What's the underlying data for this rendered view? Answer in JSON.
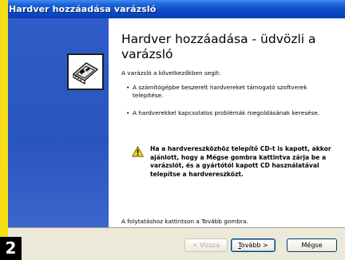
{
  "window": {
    "title": "Hardver hozzáadása varázsló"
  },
  "heading": "Hardver hozzáadása - üdvözli a varázsló",
  "intro": "A varázsló a következőkben segít:",
  "bullets": [
    "A számítógépbe beszerelt hardvereket támogató szoftverek telepítése.",
    "A hardverekkel kapcsolatos problémák megoldásának keresése."
  ],
  "warning": "Ha a hardvereszközhöz telepítő CD-t is kapott, akkor ajánlott, hogy a Mégse gombra kattintva zárja be a varázslót, és a gyártótól kapott CD használatával telepítse a hardvereszközt.",
  "footer_note": "A folytatáshoz kattintson a Tovább gombra.",
  "buttons": {
    "back": "< Vissza",
    "next_prefix": "T",
    "next_rest": "ovább >",
    "cancel": "Mégse"
  },
  "step_badge": "2",
  "icons": {
    "wizard": "hardware-card-icon",
    "warning": "warning-triangle-icon"
  },
  "colors": {
    "title_bar": "#0a4bc8",
    "side_panel": "#2e5cc8",
    "badge_yellow": "#f6df16"
  }
}
